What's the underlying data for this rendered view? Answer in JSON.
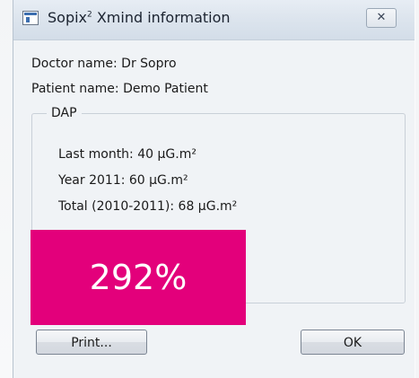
{
  "window": {
    "title": "Sopix",
    "title_superscript": "2",
    "title_suffix": " Xmind information",
    "close_label": "✕",
    "icon": "application-window-icon"
  },
  "info": {
    "doctor": "Doctor name: Dr Sopro",
    "patient": "Patient name: Demo Patient"
  },
  "dap": {
    "group_label": "DAP",
    "last_month": "Last month: 40 μG.m²",
    "year": "Year 2011:  60 μG.m²",
    "total": "Total (2010-2011): 68 μG.m²"
  },
  "buttons": {
    "print": "Print...",
    "ok": "OK"
  },
  "overlay": {
    "text": "292%",
    "color": "#e3007b"
  }
}
